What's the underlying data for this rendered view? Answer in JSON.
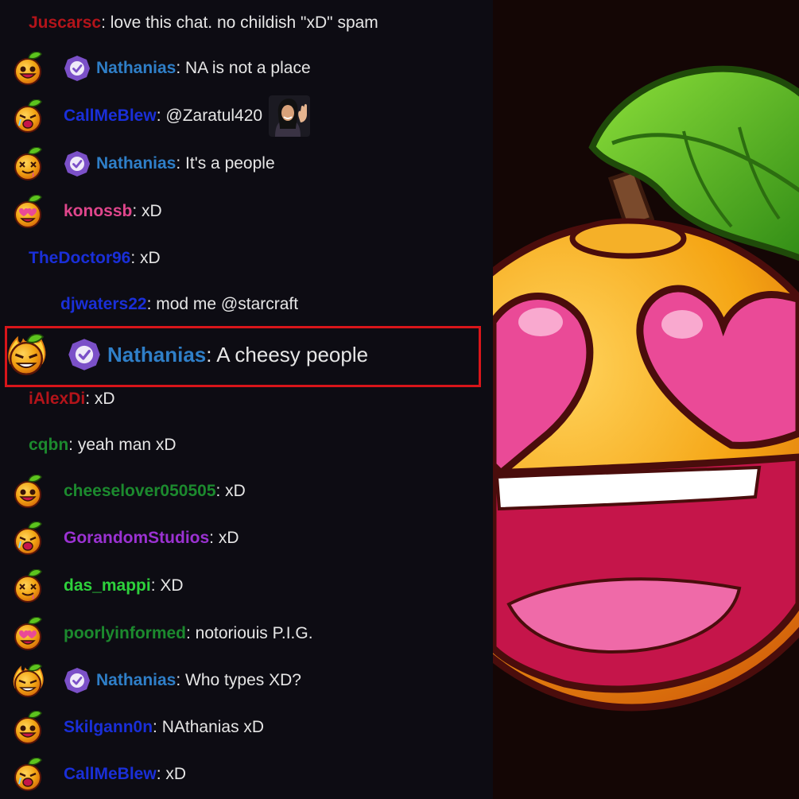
{
  "colors": {
    "chat_bg": "#0d0c13",
    "message_text": "#e6e6e6",
    "highlight_border": "#d8151a",
    "mod_badge": "#7b50c8"
  },
  "messages": [
    {
      "user": "Juscarsc",
      "text": ": love this chat. no childish \"xD\" spam",
      "color": "#b3141a",
      "emote": null,
      "mod": false
    },
    {
      "user": "Nathanias",
      "text": ": NA is not a place",
      "color": "#2f7fc8",
      "emote": "orange-grin-emote",
      "mod": true
    },
    {
      "user": "CallMeBlew",
      "text": ": @Zaratul420",
      "color": "#1a2fd8",
      "emote": "orange-cry-emote",
      "mod": false,
      "inline_emote": "waving-woman-emote"
    },
    {
      "user": "Nathanias",
      "text": ": It's a people",
      "color": "#2f7fc8",
      "emote": "orange-dizzy-emote",
      "mod": true
    },
    {
      "user": "konossb",
      "text": ": xD",
      "color": "#e0468c",
      "emote": "orange-love-emote",
      "mod": false
    },
    {
      "user": "TheDoctor96",
      "text": ": xD",
      "color": "#1a2fd8",
      "emote": null,
      "mod": false
    },
    {
      "user": "djwaters22",
      "text": ": mod me @starcraft",
      "color": "#1a2fd8",
      "emote": null,
      "mod": false
    },
    {
      "user": "iAlexDi",
      "text": ": xD",
      "color": "#b3141a",
      "emote": null,
      "mod": false
    },
    {
      "user": "cqbn",
      "text": ": yeah man xD",
      "color": "#1c8a2e",
      "emote": null,
      "mod": false
    },
    {
      "user": "cheeselover050505",
      "text": ": xD",
      "color": "#1c8a2e",
      "emote": "orange-grin-emote",
      "mod": false
    },
    {
      "user": "GorandomStudios",
      "text": ": xD",
      "color": "#9b32d2",
      "emote": "orange-cry-emote",
      "mod": false
    },
    {
      "user": "das_mappi",
      "text": ": XD",
      "color": "#2ed13c",
      "emote": "orange-dizzy-emote",
      "mod": false
    },
    {
      "user": "poorlyinformed",
      "text": ": notoriouis P.I.G.",
      "color": "#1c8a2e",
      "emote": "orange-love-emote",
      "mod": false
    },
    {
      "user": "Nathanias",
      "text": ": Who types XD?",
      "color": "#2f7fc8",
      "emote": "orange-fire-emote",
      "mod": true
    },
    {
      "user": "Skilgann0n",
      "text": ": NAthanias xD",
      "color": "#1a2fd8",
      "emote": "orange-grin-emote",
      "mod": false
    },
    {
      "user": "CallMeBlew",
      "text": ": xD",
      "color": "#1a2fd8",
      "emote": "orange-cry-emote",
      "mod": false
    }
  ],
  "highlighted_message": {
    "user": "Nathanias",
    "text": ": A cheesy people",
    "color": "#2f7fc8",
    "emote": "orange-fire-emote",
    "mod": true
  },
  "emote_panel": {
    "icon": "orange-heart-eyes-emote",
    "colors": {
      "body": "#f2a413",
      "heart": "#ea4a97",
      "leaf": "#57b51e",
      "mouth": "#c5154a"
    }
  }
}
